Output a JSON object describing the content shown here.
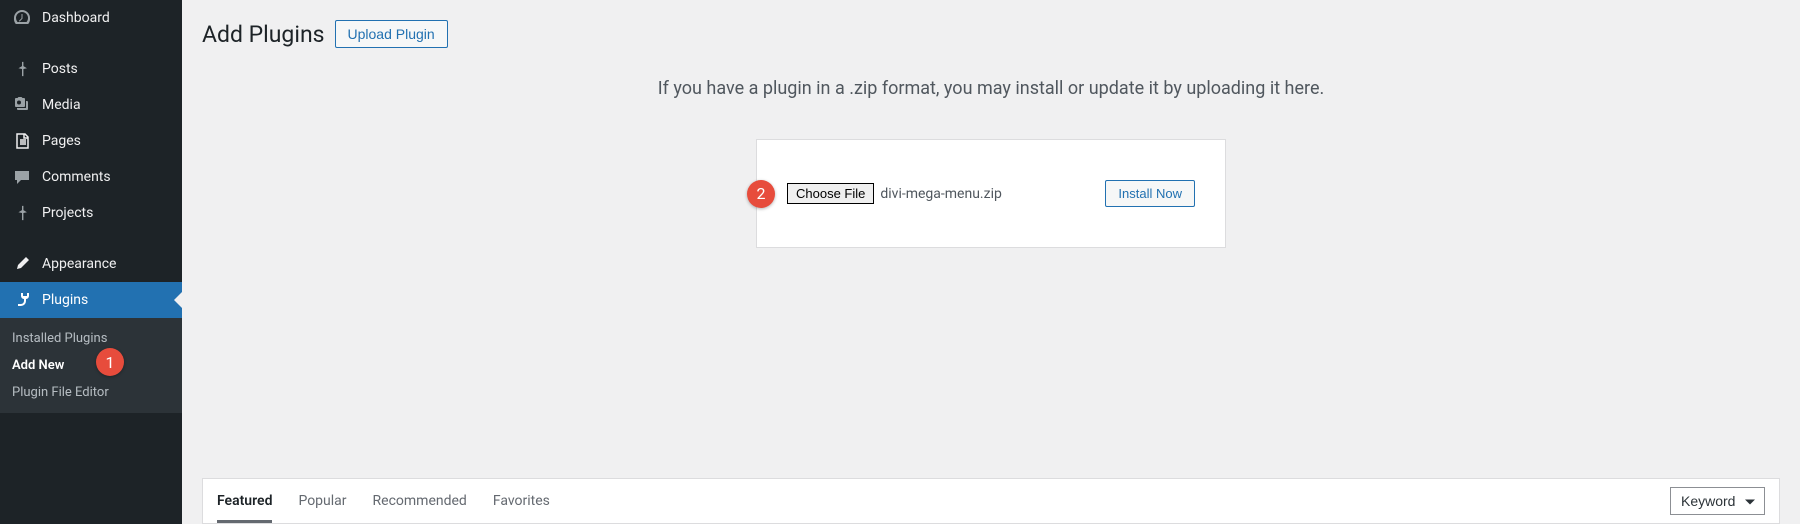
{
  "sidebar": {
    "items": [
      {
        "label": "Dashboard"
      },
      {
        "label": "Posts"
      },
      {
        "label": "Media"
      },
      {
        "label": "Pages"
      },
      {
        "label": "Comments"
      },
      {
        "label": "Projects"
      },
      {
        "label": "Appearance"
      },
      {
        "label": "Plugins"
      }
    ],
    "submenu": {
      "installed": "Installed Plugins",
      "add_new": "Add New",
      "editor": "Plugin File Editor"
    }
  },
  "header": {
    "title": "Add Plugins",
    "upload_label": "Upload Plugin"
  },
  "upload": {
    "instruction": "If you have a plugin in a .zip format, you may install or update it by uploading it here.",
    "choose_file_label": "Choose File",
    "file_name": "divi-mega-menu.zip",
    "install_label": "Install Now"
  },
  "tabs": {
    "featured": "Featured",
    "popular": "Popular",
    "recommended": "Recommended",
    "favorites": "Favorites"
  },
  "filter": {
    "selected": "Keyword"
  },
  "badges": {
    "one": "1",
    "two": "2"
  }
}
